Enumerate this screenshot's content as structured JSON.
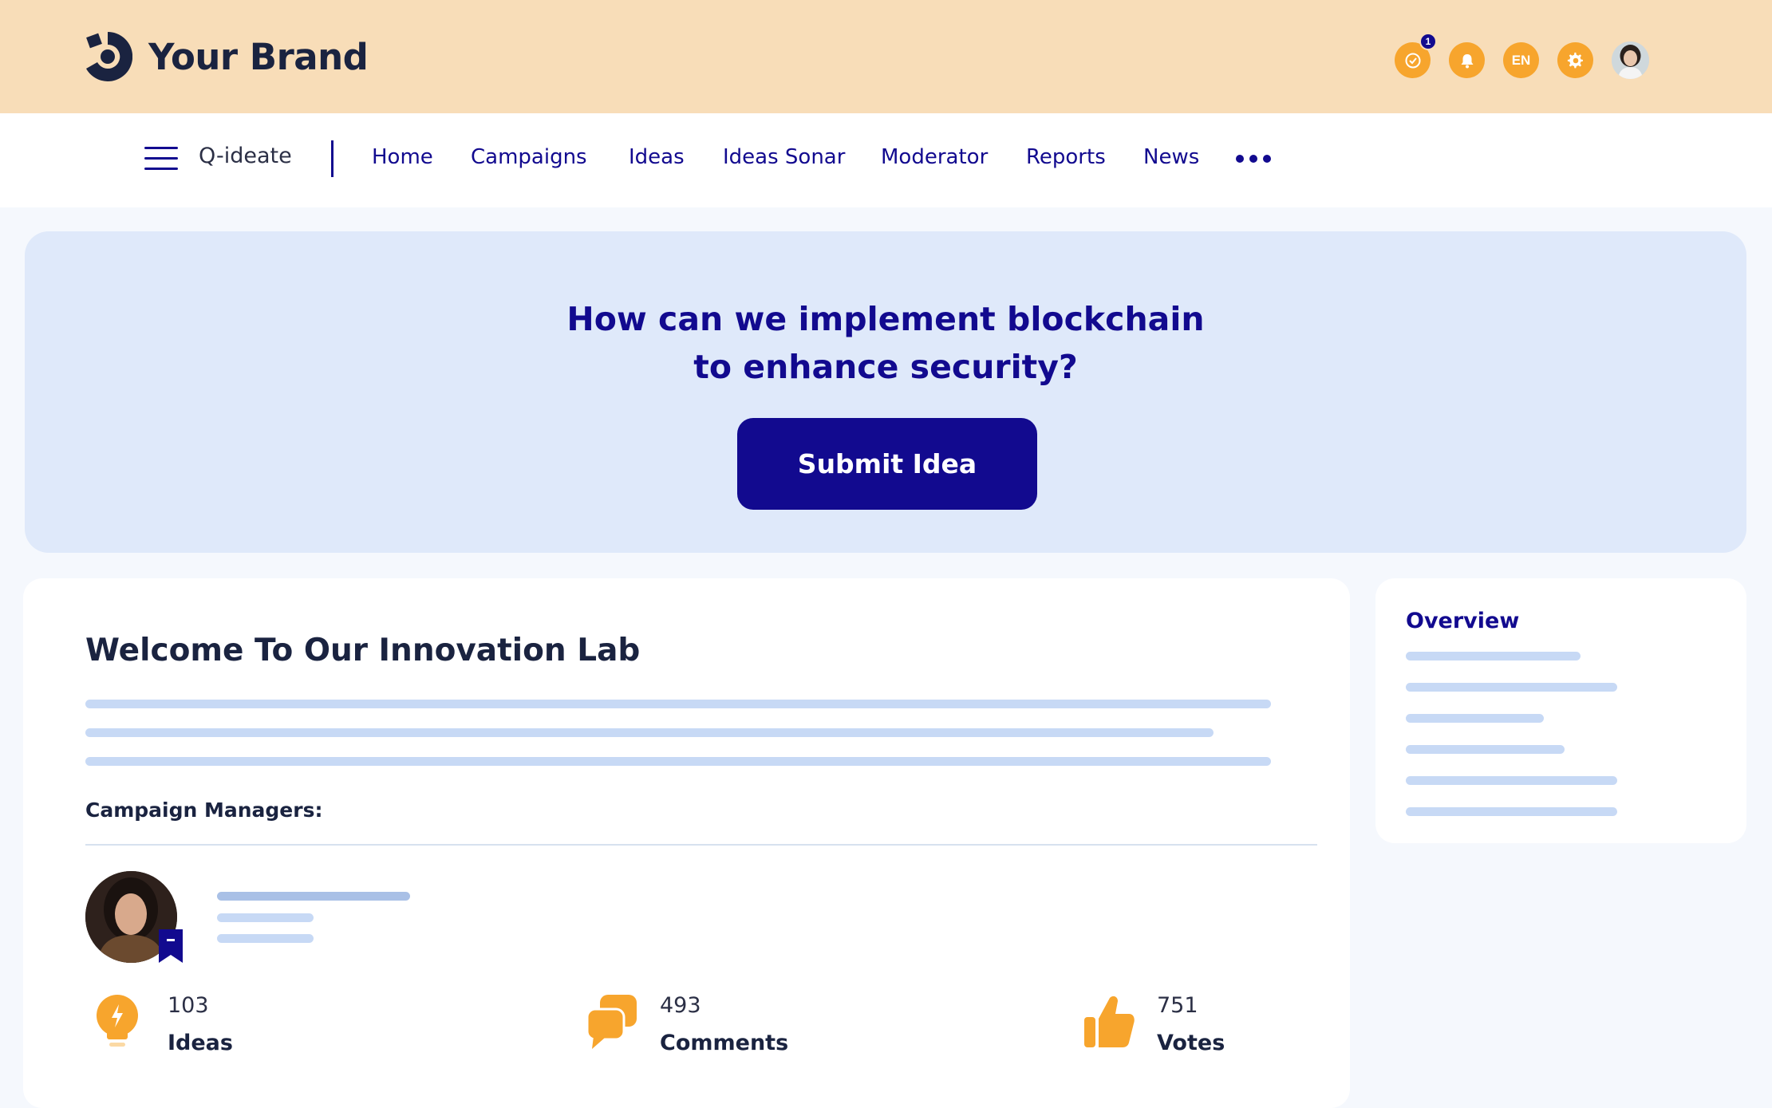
{
  "header": {
    "brand_name": "Your Brand",
    "notification_count": "1",
    "language": "EN",
    "icons": [
      "check-circle-icon",
      "bell-icon",
      "language-icon",
      "gear-icon",
      "user-avatar"
    ]
  },
  "nav": {
    "app_name": "Q-ideate",
    "items": [
      {
        "label": "Home"
      },
      {
        "label": "Campaigns"
      },
      {
        "label": "Ideas"
      },
      {
        "label": "Ideas Sonar"
      },
      {
        "label": "Moderator"
      },
      {
        "label": "Reports"
      },
      {
        "label": "News"
      }
    ]
  },
  "hero": {
    "question_line1": "How can we implement blockchain",
    "question_line2": "to enhance security?",
    "submit_label": "Submit Idea"
  },
  "main": {
    "welcome_title": "Welcome To Our Innovation Lab",
    "campaign_managers_label": "Campaign Managers:",
    "stats": [
      {
        "value": "103",
        "label": "Ideas",
        "icon": "lightbulb-icon"
      },
      {
        "value": "493",
        "label": "Comments",
        "icon": "comments-icon"
      },
      {
        "value": "751",
        "label": "Votes",
        "icon": "thumbs-up-icon"
      }
    ]
  },
  "overview": {
    "title": "Overview"
  },
  "colors": {
    "header_bg": "#f8ddb8",
    "primary": "#120a8f",
    "accent": "#f7a52d",
    "hero_bg": "#dfe9fa",
    "placeholder_line": "#c7d9f5"
  }
}
